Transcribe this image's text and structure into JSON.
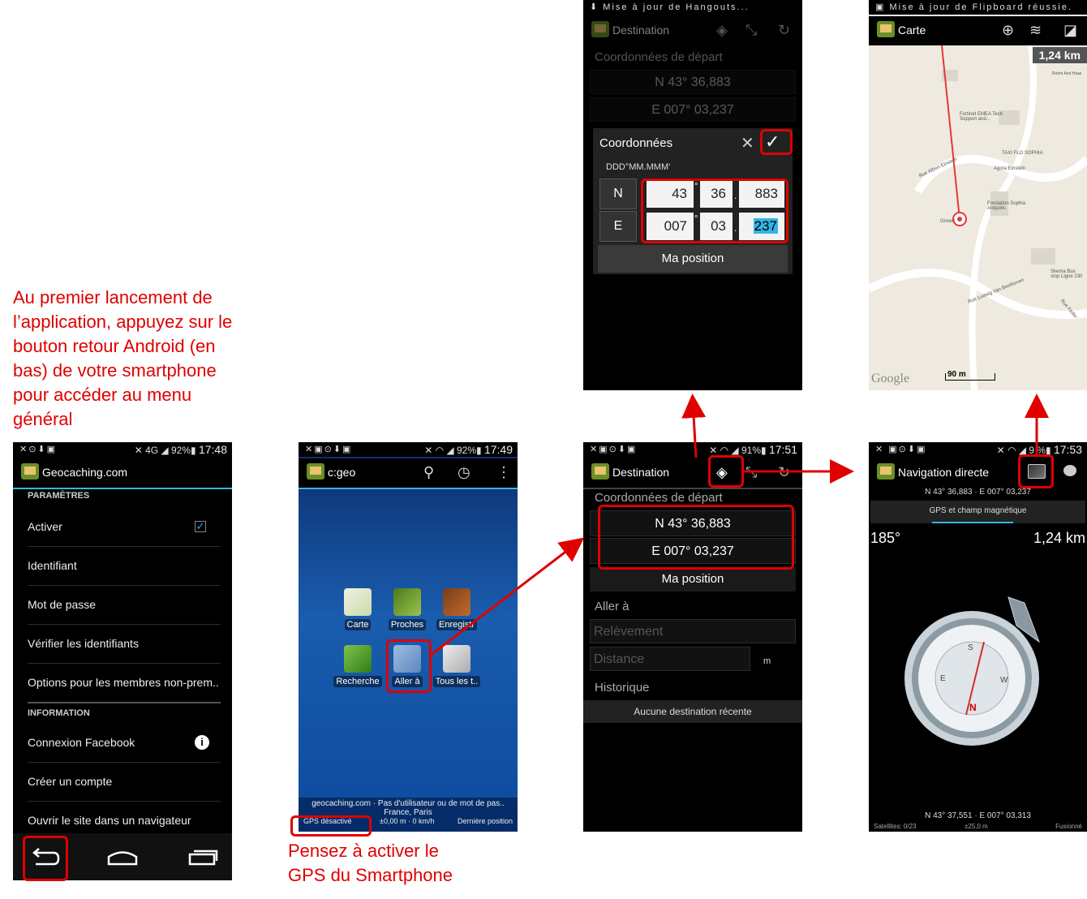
{
  "instructions": {
    "first_launch": "Au premier lancement de l’application, appuyez sur le bouton retour Android (en bas) de votre smartphone pour accéder au menu général",
    "activate_gps": "Pensez à activer le GPS du Smartphone"
  },
  "screen_settings": {
    "status": {
      "battery": "92%",
      "time": "17:48"
    },
    "title": "Geocaching.com",
    "section_params": "PARAMÈTRES",
    "activate": "Activer",
    "identifier": "Identifiant",
    "password": "Mot de passe",
    "verify": "Vérifier les identifiants",
    "options": "Options pour les membres non-prem..",
    "section_info": "INFORMATION",
    "facebook": "Connexion Facebook",
    "create": "Créer un compte",
    "open_site": "Ouvrir le site dans un navigateur"
  },
  "screen_main": {
    "status": {
      "battery": "92%",
      "time": "17:49"
    },
    "title": "c:geo",
    "apps": [
      "Carte",
      "Proches",
      "Enregistr",
      "Recherche",
      "Aller à",
      "Tous les t.."
    ],
    "footer_line1": "geocaching.com · Pas d'utilisateur ou de mot de pas..",
    "footer_line2": "France, Paris",
    "gps_status": "GPS désactivé",
    "accuracy": "±0,00 m · 0 km/h",
    "last_position": "Dernière position"
  },
  "screen_coords": {
    "notification": "Mise à jour de Hangouts...",
    "title": "Destination",
    "start_label": "Coordonnées de départ",
    "lat": "N 43° 36,883",
    "lon": "E 007° 03,237",
    "dialog_title": "Coordonnées",
    "format": "DDD°MM.MMM'",
    "n_letter": "N",
    "e_letter": "E",
    "n_deg": "43",
    "n_min": "36",
    "n_dec": "883",
    "e_deg": "007",
    "e_min": "03",
    "e_dec": "237",
    "deg_sym": "°",
    "dot": ".",
    "my_position": "Ma position"
  },
  "screen_destination": {
    "status": {
      "battery": "91%",
      "time": "17:51"
    },
    "title": "Destination",
    "start_label": "Coordonnées de départ",
    "lat": "N 43° 36,883",
    "lon": "E 007° 03,237",
    "my_position": "Ma position",
    "goto_label": "Aller à",
    "bearing_placeholder": "Relèvement",
    "distance_placeholder": "Distance",
    "unit": "m",
    "history_label": "Historique",
    "no_recent": "Aucune destination récente"
  },
  "screen_map": {
    "notification": "Mise à jour de Flipboard réussie.",
    "title": "Carte",
    "distance": "1,24 km",
    "scale": "90 m",
    "google": "Google",
    "labels": [
      "Fortinet EMEA Tech Support and...",
      "TAXI FLO SOPHIA",
      "Agora Einstein",
      "Fondation Sophia Antipolis",
      "Rue Albert Einstein",
      "Gnvert",
      "Skema Bus stop Ligne 230",
      "Rue Ludwig Van Beethoven",
      "Rue Fedor",
      "Rohm And Haas"
    ]
  },
  "screen_nav": {
    "status": {
      "battery": "9 %",
      "time": "17:53"
    },
    "title": "Navigation directe",
    "target": "N 43° 36,883 · E 007° 03,237",
    "mode": "GPS et champ magnétique",
    "heading": "185°",
    "distance": "1,24 km",
    "current": "N 43° 37,551 · E 007° 03,313",
    "satellites": "Satellites: 0/23",
    "accuracy": "±25,0 m",
    "merge": "Fusionné"
  },
  "colors": {
    "accent_red": "#e00000",
    "holo_blue": "#33b5e5"
  }
}
